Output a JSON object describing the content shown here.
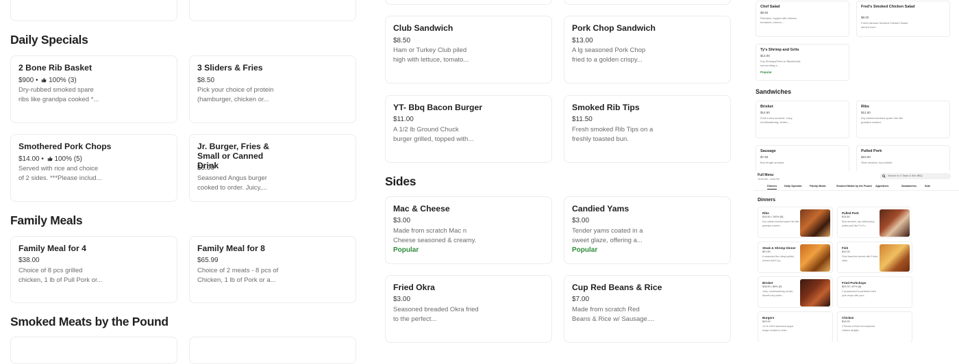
{
  "left": {
    "sections": [
      {
        "title": "Daily Specials",
        "items": [
          {
            "name": "2 Bone Rib Basket",
            "price": "$900 •",
            "rating": "100% (3)",
            "desc": "Dry-rubbed smoked spare ribs like grandpa cooked *..."
          },
          {
            "name": "3 Sliders & Fries",
            "price": "$8.50",
            "desc": "Pick your choice of protein (hamburger, chicken or..."
          },
          {
            "name": "Smothered Pork Chops",
            "price": "$14.00 •",
            "rating": "100% (5)",
            "desc": "Served with rice and choice of 2 sides. ***Please includ..."
          },
          {
            "name": "Jr. Burger, Fries & Small or Canned Drink",
            "price": "$8.00",
            "desc": "Seasoned Angus burger cooked to order. Juicy,..."
          }
        ]
      },
      {
        "title": "Family Meals",
        "items": [
          {
            "name": "Family Meal for 4",
            "price": "$38.00",
            "desc": "Choice of 8 pcs grilled chicken, 1 lb of Pull Pork or..."
          },
          {
            "name": "Family Meal for 8",
            "price": "$65.99",
            "desc": "Choice of 2 meats - 8 pcs of Chicken, 1 lb of Pork or a..."
          }
        ]
      },
      {
        "title": "Smoked Meats by the Pound"
      }
    ]
  },
  "middle": {
    "sandwiches": [
      {
        "name": "Club Sandwich",
        "price": "$8.50",
        "desc": "Ham or Turkey Club piled high with lettuce, tomato..."
      },
      {
        "name": "Pork Chop Sandwich",
        "price": "$13.00",
        "desc": "A lg seasoned Pork Chop fried to a golden crispy..."
      },
      {
        "name": "YT- Bbq Bacon Burger",
        "price": "$11.00",
        "desc": "A 1/2 lb Ground Chuck burger grilled, topped with..."
      },
      {
        "name": "Smoked Rib Tips",
        "price": "$11.50",
        "desc": "Fresh smoked Rib Tips on a freshly toasted bun."
      }
    ],
    "sides_title": "Sides",
    "sides": [
      {
        "name": "Mac & Cheese",
        "price": "$3.00",
        "desc": "Made from scratch Mac n Cheese seasoned & creamy.",
        "badge": "Popular"
      },
      {
        "name": "Candied Yams",
        "price": "$3.00",
        "desc": "Tender yams coated in a sweet glaze, offering a...",
        "badge": "Popular"
      },
      {
        "name": "Fried Okra",
        "price": "$3.00",
        "desc": "Seasoned breaded Okra fried to the perfect..."
      },
      {
        "name": "Cup Red Beans & Rice",
        "price": "$7.00",
        "desc": "Made from scratch Red Beans & Rice w/ Sausage...."
      }
    ]
  },
  "preview": {
    "top_cards": [
      {
        "name": "Chef Salad",
        "price": "$9.50",
        "desc": "Romaine, topped with cheese, tomatoes, onions,..."
      },
      {
        "name": "Fred's Smoked Chicken Salad",
        "price": "$8.00",
        "desc": "Fred's famous Smoked Chicken Salad served over..."
      },
      {
        "name": "Ty's Shrimp and Grits",
        "price": "$12.00",
        "desc": "5 lg Shrimps(Fried or Blackened) surrounding a...",
        "badge": "Popular"
      }
    ],
    "sandwiches_title": "Sandwiches",
    "sandwich_cards": [
      {
        "name": "Brisket",
        "price": "$14.50",
        "desc": "Fred's slow smoked. Juicy, mouthwatering, tender,..."
      },
      {
        "name": "Ribs",
        "price": "$12.50",
        "desc": "Dry-rubbed smoked spare ribs like grandpa cooked."
      },
      {
        "name": "Sausage",
        "price": "$7.50",
        "desc": "Bun length smoked"
      },
      {
        "name": "Pulled Pork",
        "price": "$10.00",
        "desc": "Slow smoked, dry-rubbed"
      }
    ],
    "full_menu": "Full Menu",
    "hours": "10:00 AM – 8:45 PM",
    "search_placeholder": "Search in O Taste & See BBQ",
    "tabs": [
      "Dinners",
      "Daily Specials",
      "Family Meals",
      "Smoked Meats by the Pound",
      "Appetizers",
      "Sandwiches",
      "Side"
    ],
    "dinners_title": "Dinners",
    "dinner_cards": [
      {
        "name": "Ribs",
        "price": "$14.50 • 100% (8)",
        "desc": "Dry-rubbed smoked spare ribs like grandpa cooked..."
      },
      {
        "name": "Pulled Pork",
        "price": "$13.50",
        "desc": "Slow smoked, dry-rubbed juicy pulled pork like Fo Fo..."
      },
      {
        "name": "Steak & Shrimp Dinner",
        "price": "$21.50",
        "desc": "A seasoned 8oz ribeye grilled, served with 5 Lg..."
      },
      {
        "name": "Fish",
        "price": "$12.00",
        "desc": "Fried bass fish served with 2 fried sides"
      },
      {
        "name": "Brisket",
        "price": "$18.50 • 88% (9)",
        "desc": "Juicy, mouthwatering, tender, flavorful dry-rubbe..."
      },
      {
        "name": "Fried Porkchops",
        "price": "$22.00 • 87% (8)",
        "desc": "2 lg seasoned to perfection fried pork chops with your..."
      },
      {
        "name": "Burgers",
        "price": "$12.00",
        "desc": "1/2 lb 100% seasoned angus burger cooked to order..."
      },
      {
        "name": "Chicken",
        "price": "$13.00",
        "desc": "3 Pieces of fresh hot seasoned chicken straight..."
      }
    ]
  }
}
